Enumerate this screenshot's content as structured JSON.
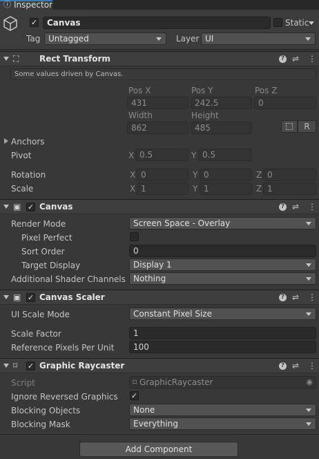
{
  "tab": {
    "label": "Inspector"
  },
  "gameobject": {
    "active": true,
    "name": "Canvas",
    "static_label": "Static",
    "tag_label": "Tag",
    "tag_value": "Untagged",
    "layer_label": "Layer",
    "layer_value": "UI"
  },
  "rect_transform": {
    "title": "Rect Transform",
    "driven_note": "Some values driven by Canvas.",
    "pos_x_label": "Pos X",
    "pos_y_label": "Pos Y",
    "pos_z_label": "Pos Z",
    "pos_x": "431",
    "pos_y": "242.5",
    "pos_z": "0",
    "width_label": "Width",
    "height_label": "Height",
    "width": "862",
    "height": "485",
    "r_button": "R",
    "anchors_label": "Anchors",
    "pivot_label": "Pivot",
    "pivot_x": "0.5",
    "pivot_y": "0.5",
    "rotation_label": "Rotation",
    "rot_x": "0",
    "rot_y": "0",
    "rot_z": "0",
    "scale_label": "Scale",
    "scale_x": "1",
    "scale_y": "1",
    "scale_z": "1",
    "axis_x": "X",
    "axis_y": "Y",
    "axis_z": "Z"
  },
  "canvas": {
    "title": "Canvas",
    "enabled": true,
    "render_mode_label": "Render Mode",
    "render_mode": "Screen Space - Overlay",
    "pixel_perfect_label": "Pixel Perfect",
    "pixel_perfect": false,
    "sort_order_label": "Sort Order",
    "sort_order": "0",
    "target_display_label": "Target Display",
    "target_display": "Display 1",
    "shader_channels_label": "Additional Shader Channels",
    "shader_channels": "Nothing"
  },
  "canvas_scaler": {
    "title": "Canvas Scaler",
    "enabled": true,
    "ui_scale_mode_label": "UI Scale Mode",
    "ui_scale_mode": "Constant Pixel Size",
    "scale_factor_label": "Scale Factor",
    "scale_factor": "1",
    "ref_ppu_label": "Reference Pixels Per Unit",
    "ref_ppu": "100"
  },
  "graphic_raycaster": {
    "title": "Graphic Raycaster",
    "enabled": true,
    "script_label": "Script",
    "script_value": "GraphicRaycaster",
    "ignore_reversed_label": "Ignore Reversed Graphics",
    "ignore_reversed": true,
    "blocking_objects_label": "Blocking Objects",
    "blocking_objects": "None",
    "blocking_mask_label": "Blocking Mask",
    "blocking_mask": "Everything"
  },
  "add_component_label": "Add Component",
  "colors": {
    "background": "#383838",
    "header": "#3e3e3e",
    "field": "#2a2a2a",
    "dropdown": "#515151",
    "text": "#c4c4c4"
  }
}
